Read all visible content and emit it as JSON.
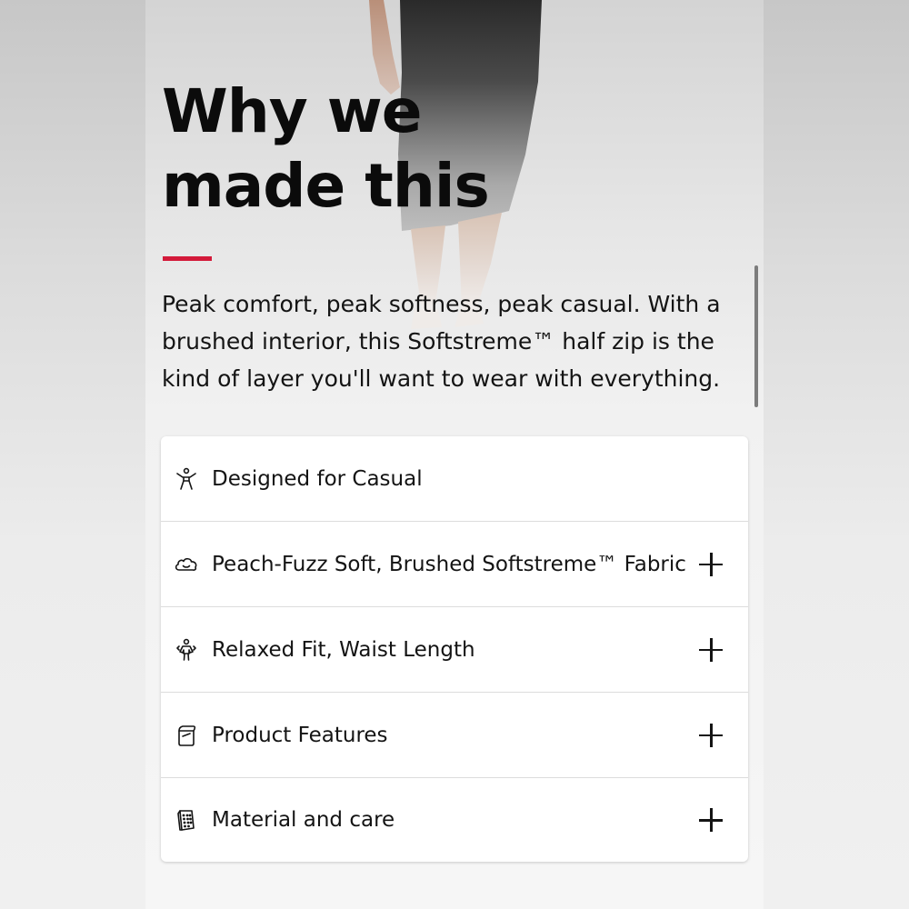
{
  "section": {
    "heading_line1": "Why we",
    "heading_line2": "made this",
    "description": "Peak comfort, peak softness, peak casual. With a brushed interior, this Softstreme™ half zip is the kind of layer you'll want to wear with everything."
  },
  "accordion": {
    "items": [
      {
        "label": "Designed for Casual",
        "icon": "person-stretch-icon",
        "expandable": false
      },
      {
        "label": "Peach-Fuzz Soft, Brushed Softstreme™ Fabric",
        "icon": "cloud-smile-icon",
        "expandable": true
      },
      {
        "label": "Relaxed Fit, Waist Length",
        "icon": "person-fit-icon",
        "expandable": true
      },
      {
        "label": "Product Features",
        "icon": "garment-tag-icon",
        "expandable": true
      },
      {
        "label": "Material and care",
        "icon": "fabric-swatch-icon",
        "expandable": true
      }
    ]
  },
  "colors": {
    "accent": "#d31a3a",
    "text": "#141414",
    "card": "#ffffff"
  }
}
